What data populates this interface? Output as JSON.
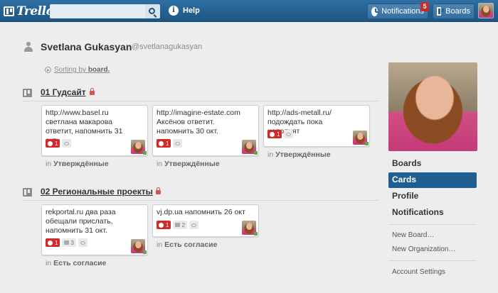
{
  "header": {
    "logo": "Trello",
    "search_value": "",
    "help": "Help",
    "notifications": "Notifications",
    "notification_count": "5",
    "boards": "Boards"
  },
  "profile": {
    "name": "Svetlana Gukasyan",
    "handle": "@svetlanagukasyan",
    "sorting_prefix": "Sorting by",
    "sorting_value": "board."
  },
  "boards": [
    {
      "title": "01 Гудсайт",
      "cards": [
        {
          "text": "http://www.basel.ru светлана макарова ответит, напомнить 31 окт.",
          "due": "1",
          "comments": "",
          "list": "Утверждённые"
        },
        {
          "text": "http://imagine-estate.com Аксёнов ответит. напомнить 30 окт.",
          "due": "1",
          "comments": "",
          "list": "Утверждённые"
        },
        {
          "text": "http://ads-metall.ru/ подождать пока наполнят",
          "due": "1",
          "comments": "",
          "list": "Утверждённые"
        }
      ]
    },
    {
      "title": "02 Региональные проекты",
      "cards": [
        {
          "text": "rekportal.ru два раза обещали прислать, напомнить 31 окт.",
          "due": "1",
          "comments": "3",
          "list": "Есть согласие"
        },
        {
          "text": "vj.dp.ua напомнить 26 окт",
          "due": "1",
          "comments": "2",
          "list": "Есть согласие"
        }
      ]
    }
  ],
  "in_label": "in",
  "sidebar": {
    "nav": [
      "Boards",
      "Cards",
      "Profile",
      "Notifications"
    ],
    "active": "Cards",
    "links": [
      "New Board…",
      "New Organization…",
      "Account Settings"
    ]
  }
}
